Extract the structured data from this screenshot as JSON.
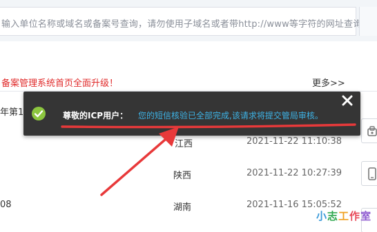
{
  "search": {
    "placeholder": "输入单位名称或域名或备案号查询，请勿使用子域名或者带http://www等字符的网址查询"
  },
  "news": {
    "headline": "备案管理系统首页全面升级！",
    "more_label": "更多>>"
  },
  "rows": [
    {
      "name": "年第1",
      "province": "",
      "time": ""
    },
    {
      "name": "",
      "province": "江西",
      "time": "2021-11-22 11:10:38"
    },
    {
      "name": "",
      "province": "陕西",
      "time": "2021-11-22 10:27:39"
    },
    {
      "name": "08",
      "province": "湖南",
      "time": "2021-11-16 15:05:52"
    }
  ],
  "toast": {
    "title": "尊敬的ICP用户：",
    "message": "您的短信核验已全部完成,该请求将提交管局审核。",
    "close_glyph": "✕"
  },
  "watermark": {
    "chars": [
      "小",
      "志",
      "工",
      "作",
      "室"
    ]
  },
  "colors": {
    "headline_red": "#e02a2a",
    "toast_bg": "#262626",
    "toast_link": "#3db3e6",
    "check_green": "#8cc63f",
    "annotation_red": "#e8393a"
  },
  "icons": {
    "check": "check-circle-icon",
    "close": "close-icon",
    "phone": "phone-icon",
    "mobile": "mobile-icon"
  }
}
